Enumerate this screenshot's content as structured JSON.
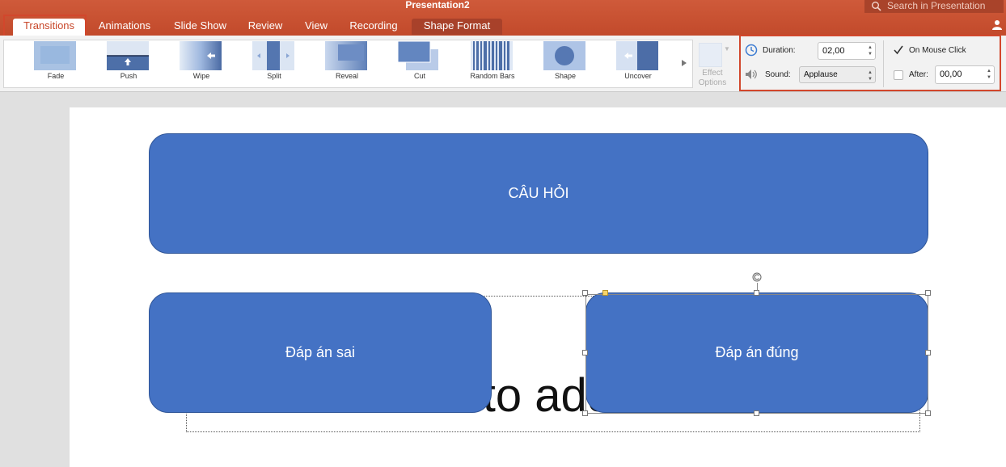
{
  "window": {
    "title": "Presentation2"
  },
  "search": {
    "placeholder": "Search in Presentation"
  },
  "tabs": [
    {
      "label": "Transitions",
      "active": true
    },
    {
      "label": "Animations"
    },
    {
      "label": "Slide Show"
    },
    {
      "label": "Review"
    },
    {
      "label": "View"
    },
    {
      "label": "Recording"
    },
    {
      "label": "Shape Format",
      "contextual": true
    }
  ],
  "transitions": [
    {
      "label": "Fade"
    },
    {
      "label": "Push"
    },
    {
      "label": "Wipe"
    },
    {
      "label": "Split"
    },
    {
      "label": "Reveal"
    },
    {
      "label": "Cut"
    },
    {
      "label": "Random Bars"
    },
    {
      "label": "Shape"
    },
    {
      "label": "Uncover"
    }
  ],
  "effect_options": {
    "line1": "Effect",
    "line2": "Options"
  },
  "timing": {
    "duration_label": "Duration:",
    "duration_value": "02,00",
    "sound_label": "Sound:",
    "sound_value": "Applause",
    "on_mouse_click_label": "On Mouse Click",
    "on_mouse_click_checked": true,
    "after_label": "After:",
    "after_value": "00,00",
    "after_checked": false
  },
  "slide": {
    "question": "CÂU HỎI",
    "wrong_answer": "Đáp án sai",
    "right_answer": "Đáp án đúng",
    "placeholder_text": "Click to add"
  },
  "colors": {
    "ribbon": "#c8502f",
    "accent": "#d2472c",
    "shape_fill": "#4472c4"
  }
}
